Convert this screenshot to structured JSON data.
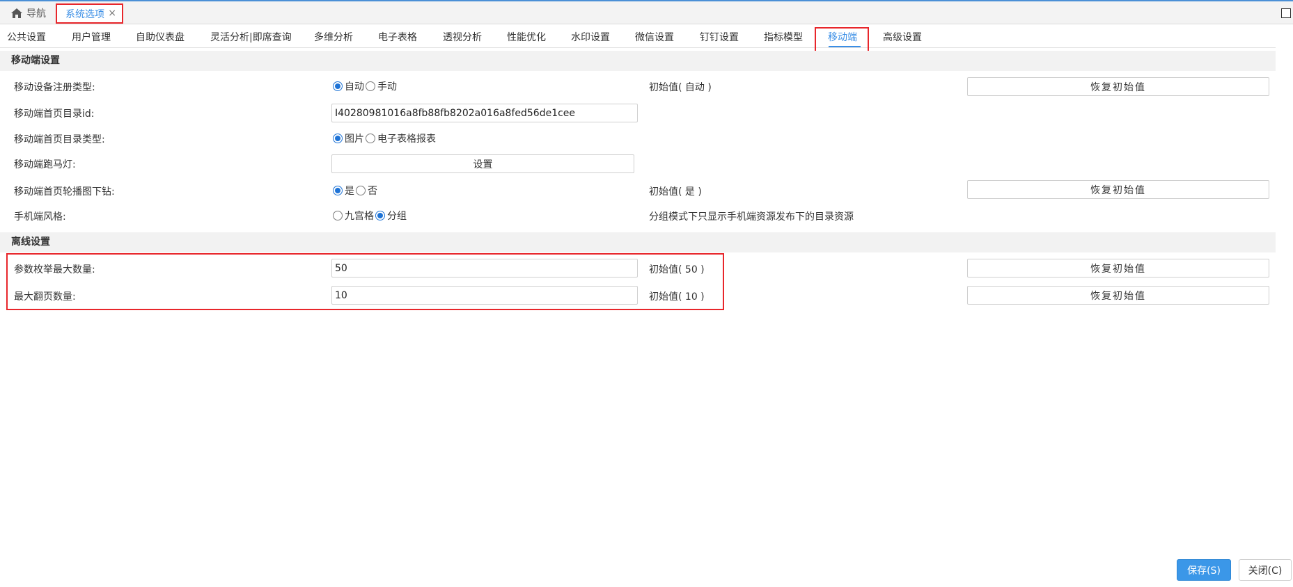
{
  "nav": {
    "home_label": "导航",
    "active_tab_label": "系统选项",
    "close_glyph": "×"
  },
  "subtabs": [
    "公共设置",
    "用户管理",
    "自助仪表盘",
    "灵活分析|即席查询",
    "多维分析",
    "电子表格",
    "透视分析",
    "性能优化",
    "水印设置",
    "微信设置",
    "钉钉设置",
    "指标模型",
    "移动端",
    "高级设置"
  ],
  "active_subtab": "移动端",
  "sections": {
    "mobile": "移动端设置",
    "offline": "离线设置"
  },
  "mobile": {
    "register_type": {
      "label": "移动设备注册类型:",
      "options": [
        "自动",
        "手动"
      ],
      "selected": "自动",
      "initial": "初始值( 自动 )",
      "reset": "恢复初始值"
    },
    "dir_id": {
      "label": "移动端首页目录id:",
      "value": "I40280981016a8fb88fb8202a016a8fed56de1cee"
    },
    "dir_type": {
      "label": "移动端首页目录类型:",
      "options": [
        "图片",
        "电子表格报表"
      ],
      "selected": "图片"
    },
    "marquee": {
      "label": "移动端跑马灯:",
      "button": "设置"
    },
    "carousel_drill": {
      "label": "移动端首页轮播图下钻:",
      "options": [
        "是",
        "否"
      ],
      "selected": "是",
      "initial": "初始值( 是 )",
      "reset": "恢复初始值"
    },
    "phone_style": {
      "label": "手机端风格:",
      "options": [
        "九宫格",
        "分组"
      ],
      "selected": "分组",
      "note": "分组模式下只显示手机端资源发布下的目录资源"
    }
  },
  "offline": {
    "param_max": {
      "label": "参数枚举最大数量:",
      "value": "50",
      "initial": "初始值( 50 )",
      "reset": "恢复初始值"
    },
    "page_max": {
      "label": "最大翻页数量:",
      "value": "10",
      "initial": "初始值( 10 )",
      "reset": "恢复初始值"
    }
  },
  "footer": {
    "save": "保存(S)",
    "close": "关闭(C)"
  },
  "colors": {
    "accent": "#3a8ee6",
    "highlight": "#e8262b",
    "save_bg": "#3b97e8"
  }
}
